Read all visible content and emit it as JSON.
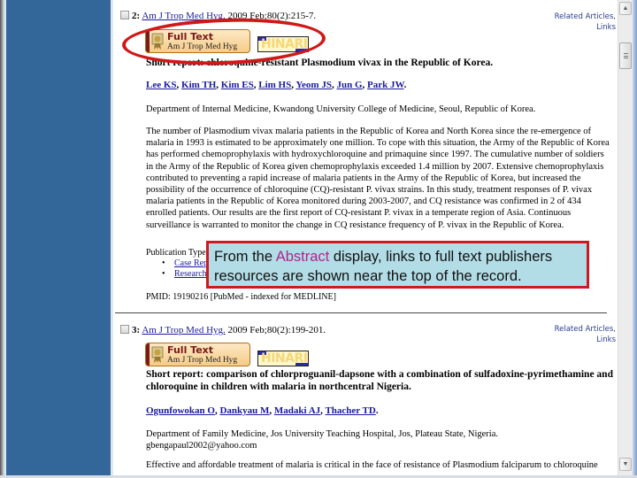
{
  "records": [
    {
      "number": "2:",
      "journal_link": "Am J Trop Med Hyg.",
      "citation": " 2009 Feb;80(2):215-7.",
      "related_articles": "Related Articles,",
      "links": "Links",
      "fulltext_button": {
        "title": "Full Text",
        "journal": "Am J Trop Med Hyg"
      },
      "hinari_logo": "HINARI",
      "title": "Short report: chloroquine-resistant Plasmodium vivax in the Republic of Korea.",
      "authors": [
        "Lee KS",
        "Kim TH",
        "Kim ES",
        "Lim HS",
        "Yeom JS",
        "Jun G",
        "Park JW"
      ],
      "affiliation": "Department of Internal Medicine, Kwandong University College of Medicine, Seoul, Republic of Korea.",
      "abstract": "The number of Plasmodium vivax malaria patients in the Republic of Korea and North Korea since the re-emergence of malaria in 1993 is estimated to be approximately one million. To cope with this situation, the Army of the Republic of Korea has performed chemoprophylaxis with hydroxychloroquine and primaquine since 1997. The cumulative number of soldiers in the Army of the Republic of Korea given chemoprophylaxis exceeded 1.4 million by 2007. Extensive chemoprophylaxis contributed to preventing a rapid increase of malaria patients in the Army of the Republic of Korea, but increased the possibility of the occurrence of chloroquine (CQ)-resistant P. vivax strains. In this study, treatment responses of P. vivax malaria patients in the Republic of Korea monitored during 2003-2007, and CQ resistance was confirmed in 2 of 434 enrolled patients. Our results are the first report of CQ-resistant P. vivax in a temperate region of Asia. Continuous surveillance is warranted to monitor the change in CQ resistance frequency of P. vivax in the Republic of Korea.",
      "publication_types_label": "Publication Types:",
      "publication_types": [
        "Case Reports",
        "Research Support, Non-U.S. Gov't"
      ],
      "pmid": "PMID: 19190216 [PubMed - indexed for MEDLINE]"
    },
    {
      "number": "3:",
      "journal_link": "Am J Trop Med Hyg.",
      "citation": " 2009 Feb;80(2):199-201.",
      "related_articles": "Related Articles,",
      "links": "Links",
      "fulltext_button": {
        "title": "Full Text",
        "journal": "Am J Trop Med Hyg"
      },
      "hinari_logo": "HINARI",
      "title": "Short report: comparison of chlorproguanil-dapsone with a combination of sulfadoxine-pyrimethamine and chloroquine in children with malaria in northcentral Nigeria.",
      "authors": [
        "Ogunfowokan O",
        "Dankyau M",
        "Madaki AJ",
        "Thacher TD"
      ],
      "affiliation": "Department of Family Medicine, Jos University Teaching Hospital, Jos, Plateau State, Nigeria.",
      "email": "gbengapaul2002@yahoo.com",
      "abstract": "Effective and affordable treatment of malaria is critical in the face of resistance of Plasmodium falciparum to chloroquine"
    }
  ],
  "callout": {
    "part1": "From the ",
    "highlight": "Abstract",
    "part2": " display, links to full text publishers resources are shown near the top of the record.",
    "highlight_color": "#b0238c",
    "border_color": "#cc1a22",
    "background": "#b3dde6"
  },
  "scrollbar": {
    "up_arrow": "▲",
    "down_arrow": "▼"
  }
}
